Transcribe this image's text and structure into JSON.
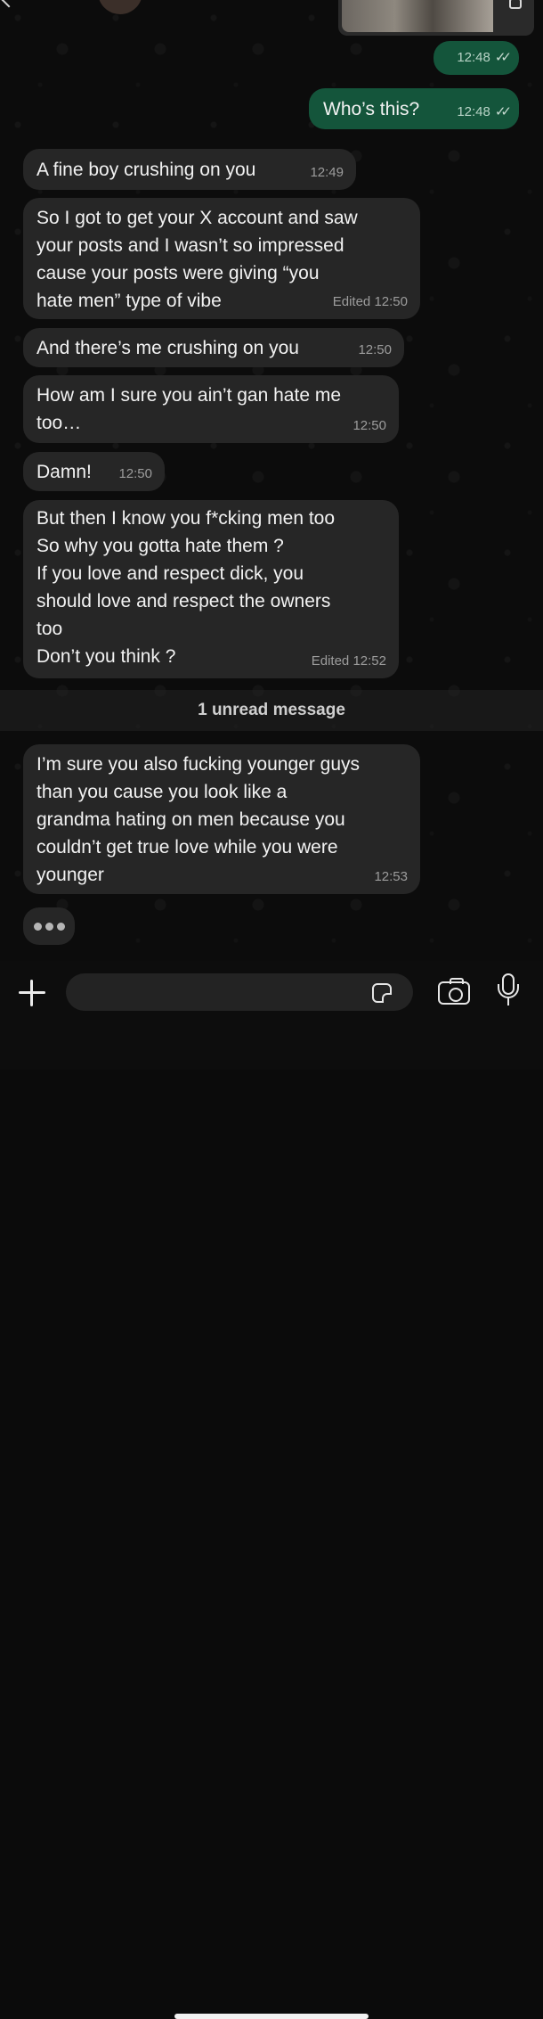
{
  "messages": [
    {
      "text": "",
      "time": "12:48",
      "edited": ""
    },
    {
      "text": "Who’s this?",
      "time": "12:48",
      "edited": ""
    },
    {
      "text": "A fine boy crushing on you",
      "time": "12:49",
      "edited": ""
    },
    {
      "text": "So I got to get your X account and saw\nyour posts and I wasn’t so impressed\ncause your posts were giving “you\nhate men” type of vibe",
      "time": "12:50",
      "edited": "Edited"
    },
    {
      "text": "And there’s me crushing on you",
      "time": "12:50",
      "edited": ""
    },
    {
      "text": "How am I sure you ain’t gan hate me\ntoo…",
      "time": "12:50",
      "edited": ""
    },
    {
      "text": "Damn!",
      "time": "12:50",
      "edited": ""
    },
    {
      "text": "But then I know you f*cking men too\nSo why you gotta hate them ?\nIf you love and respect dick, you\nshould love and respect the owners\ntoo\nDon’t you think ?",
      "time": "12:52",
      "edited": "Edited"
    },
    {
      "text": "I’m sure you also fucking younger guys\nthan you cause you look like a\ngrandma hating on men because you\ncouldn’t get true love while you were\nyounger",
      "time": "12:53",
      "edited": ""
    }
  ],
  "unread_label": "1 unread message",
  "composer": {
    "placeholder": ""
  },
  "icons": {
    "attach": "plus-icon",
    "sticker": "sticker-icon",
    "camera": "camera-icon",
    "mic": "mic-icon",
    "read_receipt": "double-check-icon",
    "typing": "typing-dots"
  },
  "colors": {
    "outgoing_bubble": "#14553b",
    "incoming_bubble": "#262626",
    "background": "#0c0c0c"
  }
}
